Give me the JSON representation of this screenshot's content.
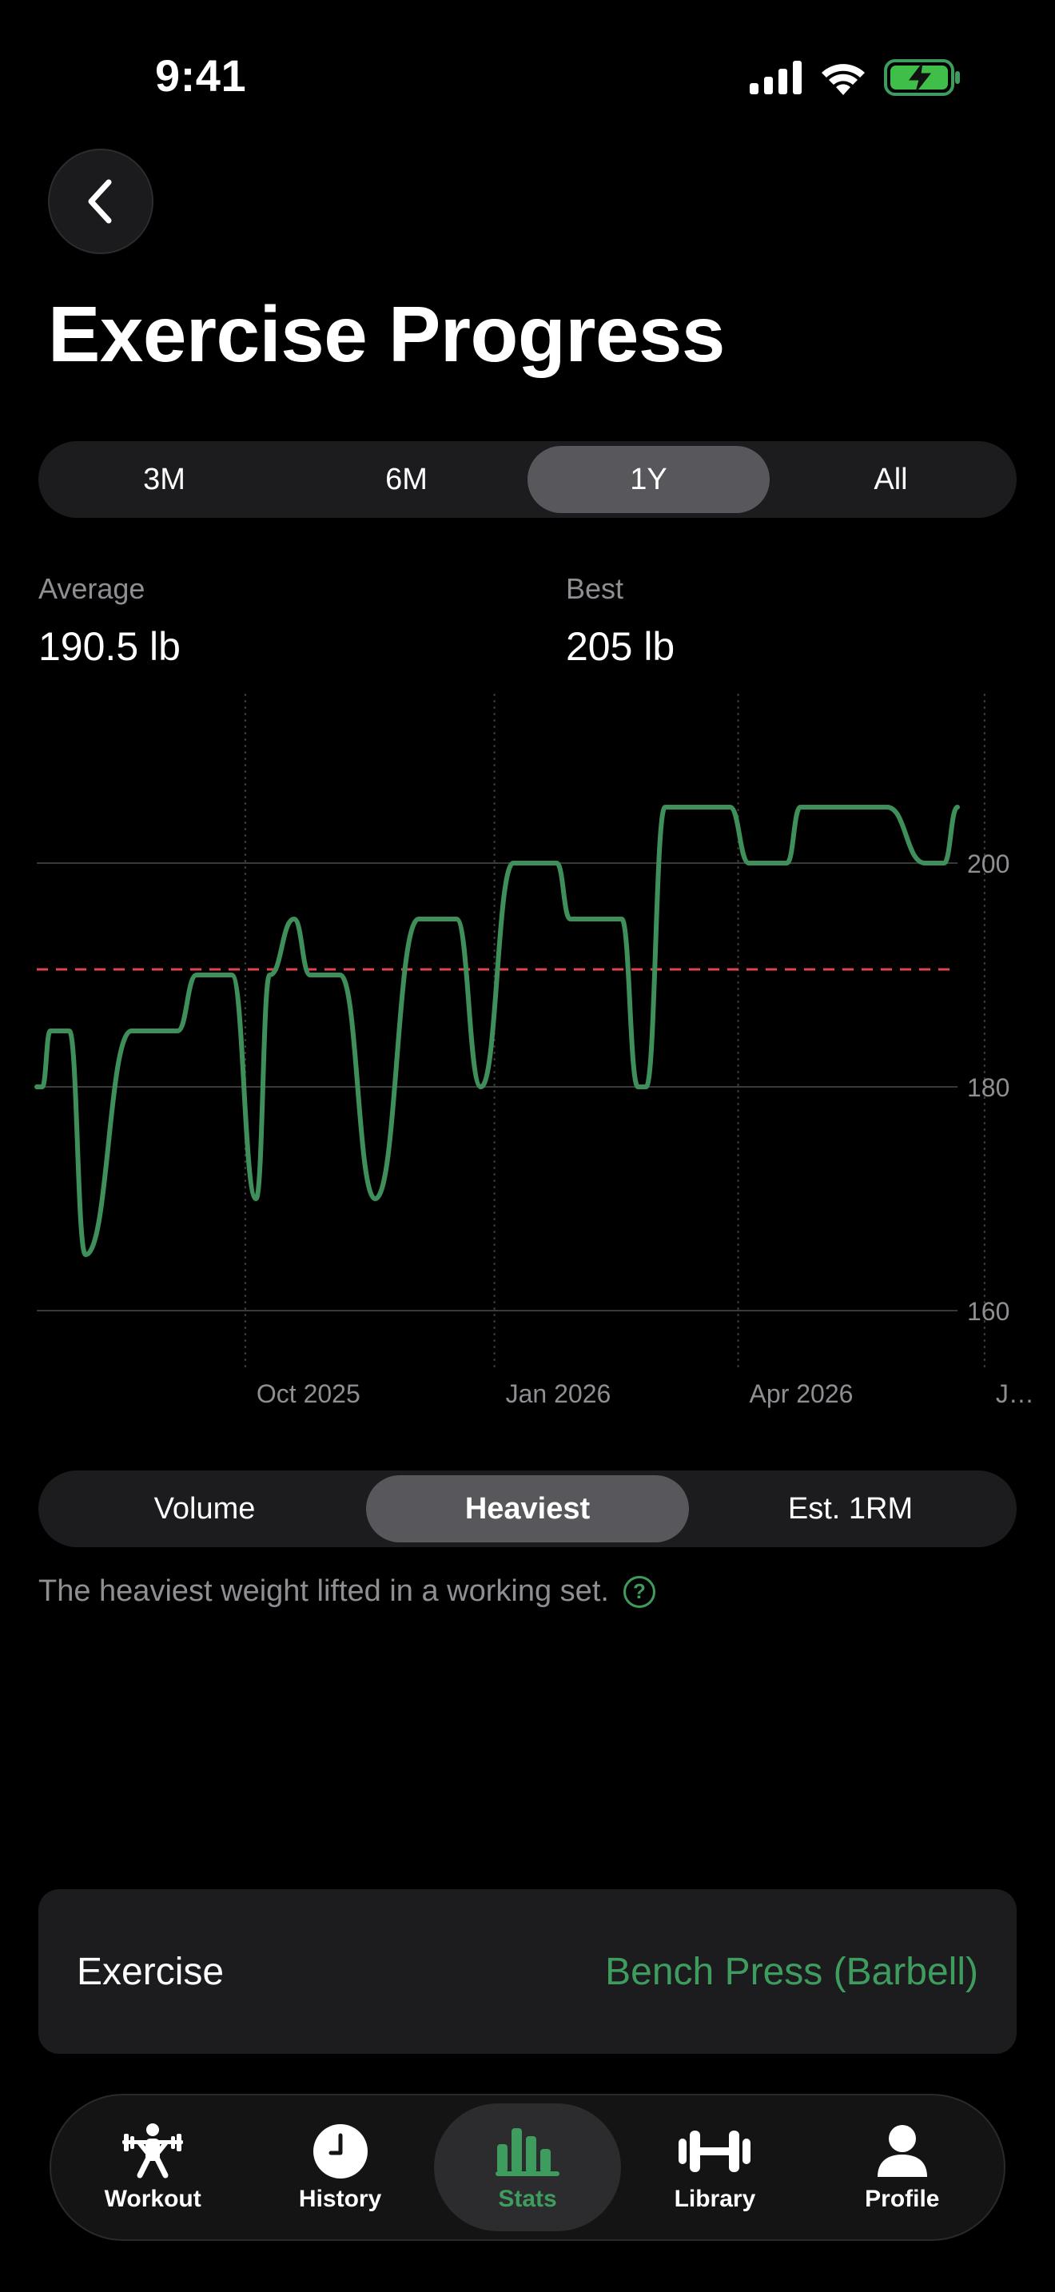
{
  "status": {
    "time": "9:41"
  },
  "title": "Exercise Progress",
  "ranges": [
    "3M",
    "6M",
    "1Y",
    "All"
  ],
  "active_range": "1Y",
  "stats": {
    "average_label": "Average",
    "average_value": "190.5 lb",
    "best_label": "Best",
    "best_value": "205 lb"
  },
  "chart_data": {
    "type": "line",
    "x": [
      "2025-07-16",
      "2025-07-18",
      "2025-07-21",
      "2025-07-28",
      "2025-08-03",
      "2025-08-20",
      "2025-08-27",
      "2025-09-06",
      "2025-09-13",
      "2025-09-26",
      "2025-10-05",
      "2025-10-10",
      "2025-10-19",
      "2025-10-25",
      "2025-11-05",
      "2025-11-18",
      "2025-12-04",
      "2025-12-09",
      "2025-12-18",
      "2025-12-27",
      "2026-01-08",
      "2026-01-24",
      "2026-01-29",
      "2026-02-17",
      "2026-02-23",
      "2026-02-26",
      "2026-03-05",
      "2026-03-10",
      "2026-03-29",
      "2026-04-05",
      "2026-04-19",
      "2026-04-24",
      "2026-05-07",
      "2026-05-26",
      "2026-06-09",
      "2026-06-16",
      "2026-06-21"
    ],
    "y": [
      180,
      180,
      185,
      185,
      165,
      185,
      185,
      185,
      190,
      190,
      170,
      190,
      195,
      190,
      190,
      170,
      195,
      195,
      195,
      180,
      200,
      200,
      195,
      195,
      180,
      180,
      205,
      205,
      205,
      200,
      200,
      205,
      205,
      205,
      200,
      200,
      205
    ],
    "xticks": [
      "Oct 2025",
      "Jan 2026",
      "Apr 2026",
      "J…"
    ],
    "yticks": [
      160,
      180,
      200
    ],
    "ylim": [
      155,
      210
    ],
    "average": 190.5,
    "colors": {
      "line": "#3e8f5a",
      "average": "#e0454b"
    }
  },
  "metrics": [
    "Volume",
    "Heaviest",
    "Est. 1RM"
  ],
  "active_metric": "Heaviest",
  "description": "The heaviest weight lifted in a working set.",
  "help_glyph": "?",
  "exercise": {
    "label": "Exercise",
    "value": "Bench Press (Barbell)"
  },
  "tabs": [
    {
      "label": "Workout",
      "icon": "workout-icon"
    },
    {
      "label": "History",
      "icon": "history-icon"
    },
    {
      "label": "Stats",
      "icon": "stats-icon"
    },
    {
      "label": "Library",
      "icon": "library-icon"
    },
    {
      "label": "Profile",
      "icon": "profile-icon"
    }
  ],
  "active_tab": "Stats",
  "accent_color": "#3e9d5e"
}
